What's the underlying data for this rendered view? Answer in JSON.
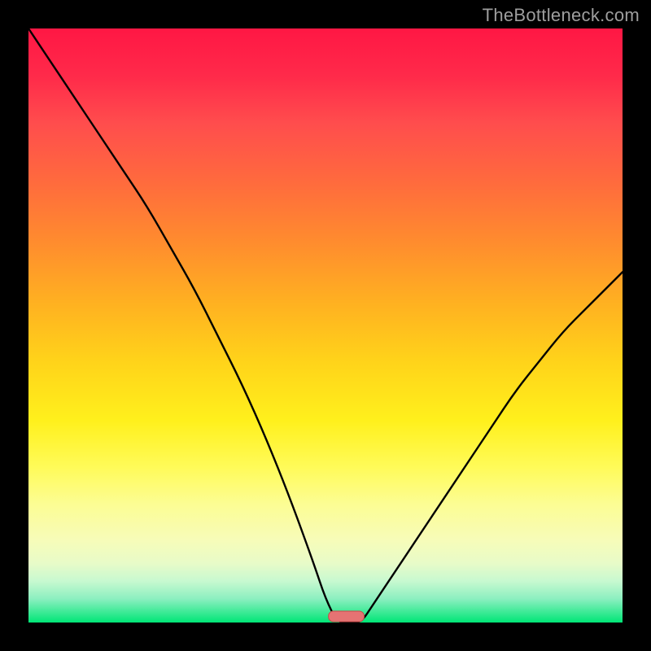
{
  "watermark": "TheBottleneck.com",
  "marker": {
    "color": "#e57373",
    "strokeColor": "#c74a4a"
  },
  "chart_data": {
    "type": "line",
    "title": "",
    "xlabel": "",
    "ylabel": "",
    "xlim": [
      0,
      100
    ],
    "ylim": [
      0,
      100
    ],
    "x": [
      0,
      4,
      8,
      12,
      16,
      20,
      24,
      28,
      32,
      36,
      40,
      44,
      48,
      50,
      52,
      54,
      56,
      58,
      62,
      66,
      70,
      74,
      78,
      82,
      86,
      90,
      94,
      98,
      100
    ],
    "series": [
      {
        "name": "bottleneck-curve",
        "values": [
          100,
          94,
          88,
          82,
          76,
          70,
          63,
          56,
          48,
          40,
          31,
          21,
          10,
          4,
          0,
          0,
          0,
          3,
          9,
          15,
          21,
          27,
          33,
          39,
          44,
          49,
          53,
          57,
          59
        ]
      }
    ],
    "marker_segment_x": [
      50.5,
      56.5
    ],
    "grid": false,
    "legend": false
  }
}
